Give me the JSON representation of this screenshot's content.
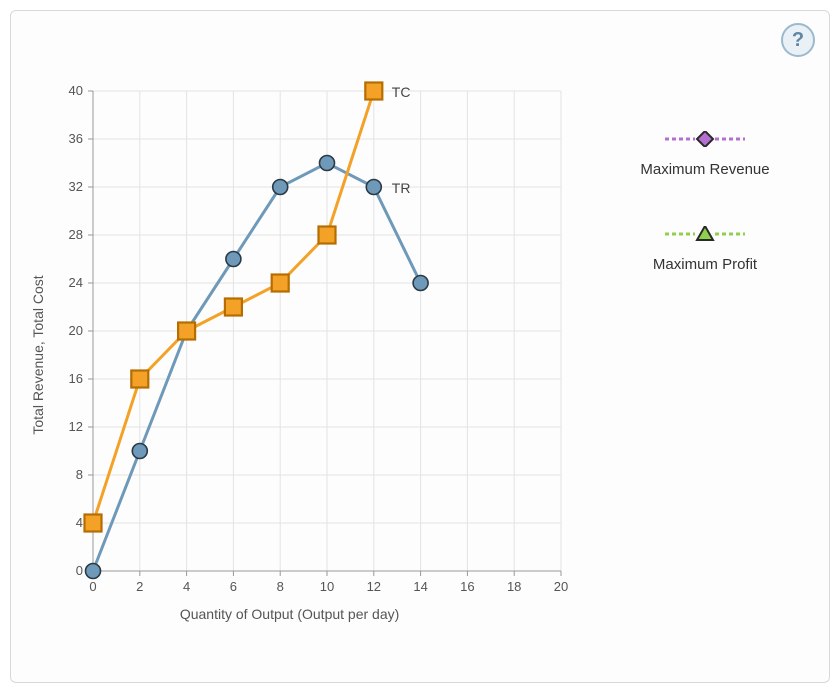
{
  "help_tooltip": "?",
  "axes": {
    "xlabel": "Quantity of Output (Output per day)",
    "ylabel": "Total Revenue, Total Cost",
    "x_ticks": [
      0,
      2,
      4,
      6,
      8,
      10,
      12,
      14,
      16,
      18,
      20
    ],
    "y_ticks": [
      0,
      4,
      8,
      12,
      16,
      20,
      24,
      28,
      32,
      36,
      40
    ]
  },
  "series_labels": {
    "tc": "TC",
    "tr": "TR"
  },
  "legend": {
    "max_revenue": "Maximum Revenue",
    "max_profit": "Maximum Profit"
  },
  "chart_data": {
    "type": "line",
    "title": "",
    "xlabel": "Quantity of Output (Output per day)",
    "ylabel": "Total Revenue, Total Cost",
    "xlim": [
      0,
      20
    ],
    "ylim": [
      0,
      40
    ],
    "x": [
      0,
      2,
      4,
      6,
      8,
      10,
      12,
      14
    ],
    "series": [
      {
        "name": "TR",
        "values": [
          0,
          10,
          20,
          26,
          32,
          34,
          32,
          24
        ],
        "color": "#6f99b9",
        "marker": "circle"
      },
      {
        "name": "TC",
        "values": [
          4,
          16,
          20,
          22,
          24,
          28,
          40,
          null
        ],
        "color": "#f3a127",
        "marker": "square"
      }
    ],
    "annotations": [
      {
        "text": "TC",
        "x": 12,
        "y": 40
      },
      {
        "text": "TR",
        "x": 12,
        "y": 32
      }
    ],
    "legend_markers": [
      {
        "name": "Maximum Revenue",
        "shape": "diamond",
        "line_color": "#b56fd1",
        "fill": "#b56fd1",
        "stroke": "#2a2a2a"
      },
      {
        "name": "Maximum Profit",
        "shape": "triangle",
        "line_color": "#8fd14c",
        "fill": "#8fd14c",
        "stroke": "#2a2a2a"
      }
    ]
  }
}
